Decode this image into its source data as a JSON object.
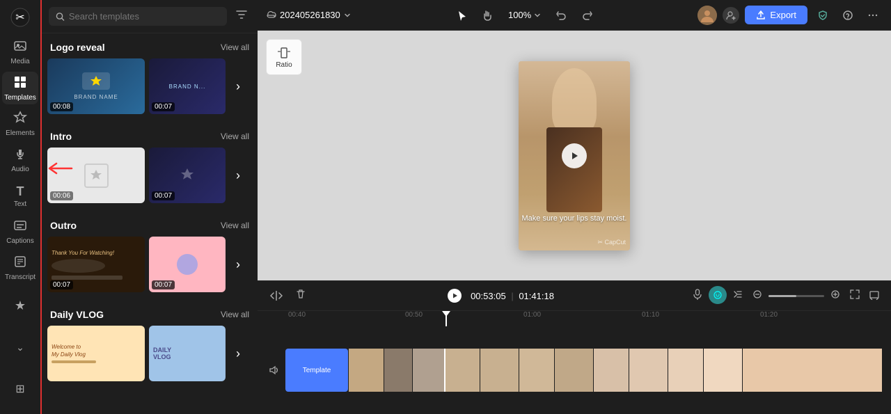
{
  "sidebar": {
    "logo": "✂",
    "items": [
      {
        "id": "media",
        "label": "Media",
        "icon": "🖼",
        "active": false
      },
      {
        "id": "templates",
        "label": "Templates",
        "icon": "▦",
        "active": true
      },
      {
        "id": "elements",
        "label": "Elements",
        "icon": "✦",
        "active": false
      },
      {
        "id": "audio",
        "label": "Audio",
        "icon": "♪",
        "active": false
      },
      {
        "id": "text",
        "label": "Text",
        "icon": "T",
        "active": false
      },
      {
        "id": "captions",
        "label": "Captions",
        "icon": "▤",
        "active": false
      },
      {
        "id": "transcript",
        "label": "Transcript",
        "icon": "≡",
        "active": false
      }
    ],
    "bottom_items": [
      {
        "id": "star",
        "icon": "★"
      },
      {
        "id": "chevron",
        "icon": "⌄"
      },
      {
        "id": "grid",
        "icon": "⊞"
      }
    ]
  },
  "search": {
    "placeholder": "Search templates"
  },
  "sections": [
    {
      "id": "logo-reveal",
      "title": "Logo reveal",
      "view_all": "View all",
      "templates": [
        {
          "duration": "00:08",
          "style": "thumb-logo"
        },
        {
          "duration": "00:07",
          "style": "thumb-logo2"
        }
      ]
    },
    {
      "id": "intro",
      "title": "Intro",
      "view_all": "View all",
      "templates": [
        {
          "duration": "00:06",
          "style": "thumb-intro",
          "has_arrow": true
        },
        {
          "duration": "00:07",
          "style": "thumb-logo2"
        }
      ]
    },
    {
      "id": "outro",
      "title": "Outro",
      "view_all": "View all",
      "templates": [
        {
          "duration": "00:07",
          "style": "thumb-outro"
        },
        {
          "duration": "00:07",
          "style": "thumb-outro2"
        }
      ]
    },
    {
      "id": "daily-vlog",
      "title": "Daily VLOG",
      "view_all": "View all",
      "templates": [
        {
          "duration": "",
          "style": "thumb-vlog"
        },
        {
          "duration": "",
          "style": "thumb-vlog2"
        }
      ]
    }
  ],
  "topbar": {
    "project_name": "202405261830",
    "zoom": "100%",
    "export_label": "Export"
  },
  "canvas": {
    "ratio_label": "Ratio",
    "video_text": "Make sure your lips stay moist.",
    "watermark": "✂ CapCut",
    "play_icon": "▶"
  },
  "timeline": {
    "time_current": "00:53:05",
    "time_total": "01:41:18",
    "ruler_marks": [
      "00:40",
      "00:50",
      "01:00",
      "01:10",
      "01:20"
    ],
    "template_label": "Template"
  }
}
